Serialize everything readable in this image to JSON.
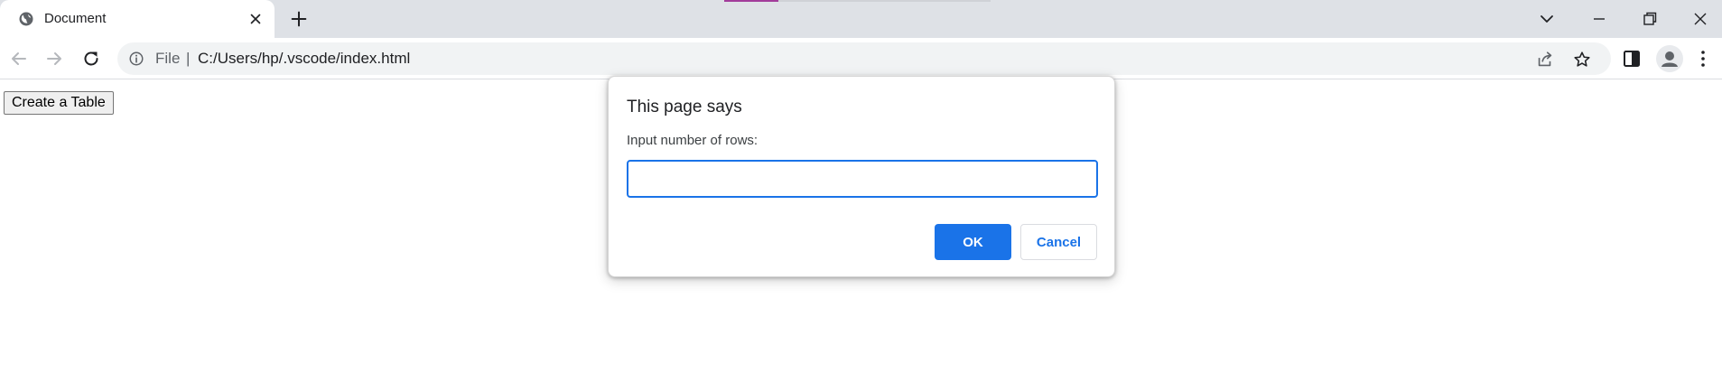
{
  "browser": {
    "tab": {
      "title": "Document",
      "favicon": "globe-icon"
    },
    "toolbar": {
      "scheme_label": "File",
      "separator": "|",
      "url": "C:/Users/hp/.vscode/index.html"
    }
  },
  "page": {
    "button_label": "Create a Table"
  },
  "dialog": {
    "title": "This page says",
    "message": "Input number of rows:",
    "input_value": "",
    "ok_label": "OK",
    "cancel_label": "Cancel"
  },
  "colors": {
    "accent": "#1a73e8",
    "tabstrip": "#dee1e6",
    "omnibox": "#f1f3f4"
  }
}
